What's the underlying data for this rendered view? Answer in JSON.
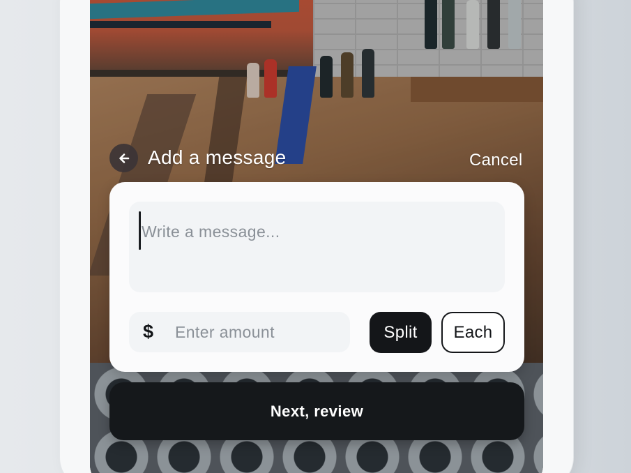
{
  "header": {
    "back_icon": "arrow-left-icon",
    "title": "Add a message",
    "cancel_label": "Cancel"
  },
  "message": {
    "placeholder": "Write a message..."
  },
  "amount": {
    "currency_symbol": "$",
    "placeholder": "Enter amount"
  },
  "mode_toggle": {
    "options": [
      "Split",
      "Each"
    ],
    "selected": "Split"
  },
  "footer": {
    "next_label": "Next, review"
  },
  "colors": {
    "primary_dark": "#141619",
    "card_bg": "#fbfbfc",
    "input_bg": "#f2f4f6",
    "placeholder_text": "#8a9097"
  }
}
